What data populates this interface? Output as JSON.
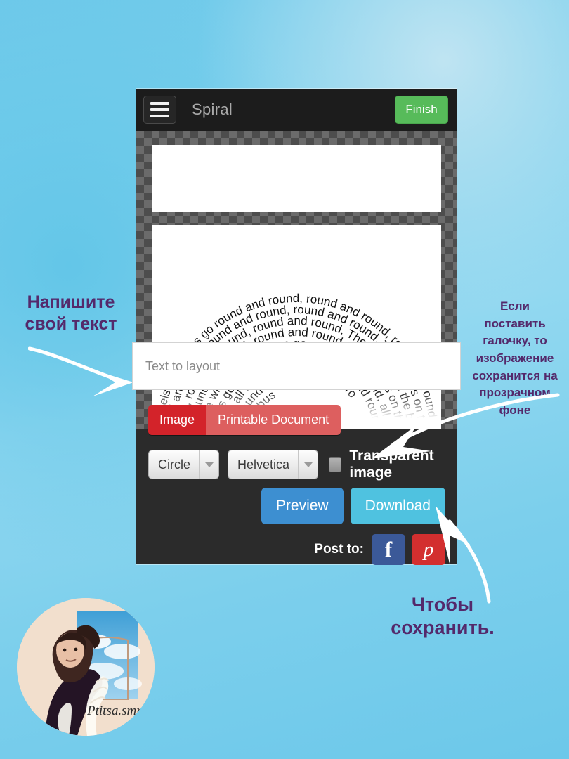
{
  "app": {
    "menu_icon": "hamburger-menu-icon",
    "title": "Spiral",
    "finish_label": "Finish"
  },
  "canvas": {
    "spiral_text": "The wheels on the bus go round and round, round and round, round and round. The wheels on the bus go round and round, all day long!"
  },
  "form": {
    "text_input_placeholder": "Text to layout",
    "text_input_value": "",
    "segment": {
      "selected": "Image",
      "options": [
        "Image",
        "Printable Document"
      ]
    },
    "shape_select": {
      "value": "Circle",
      "arrow_icon": "chevron-down-icon"
    },
    "font_select": {
      "value": "Helvetica",
      "arrow_icon": "chevron-down-icon"
    },
    "transparent_checkbox": {
      "label": "Transparent image",
      "checked": false
    },
    "preview_label": "Preview",
    "download_label": "Download",
    "post_to_label": "Post to:",
    "facebook_icon": "facebook-icon",
    "facebook_glyph": "f",
    "pinterest_icon": "pinterest-icon",
    "pinterest_glyph": "р"
  },
  "annotations": {
    "left": "Напишите\nсвой текст",
    "right": "Если\nпоставить\nгалочку, то\nизображение\nсохранится на\nпрозрачном\nфоне",
    "bottom": "Чтобы\nсохранить."
  },
  "avatar": {
    "handle": "Ptitsa.smm"
  },
  "colors": {
    "background_blue": "#79cfec",
    "annotation_purple": "#54296b",
    "finish_green": "#57bb5a",
    "segment_active_red": "#d3232a",
    "segment_inactive_red": "#dd5f5f",
    "preview_blue": "#3d8fd1",
    "download_cyan": "#4fc2e0",
    "facebook_blue": "#3b5998",
    "pinterest_red": "#d32f2f",
    "app_bar_dark": "#1c1c1c",
    "panel_dark": "#2b2b2b"
  }
}
